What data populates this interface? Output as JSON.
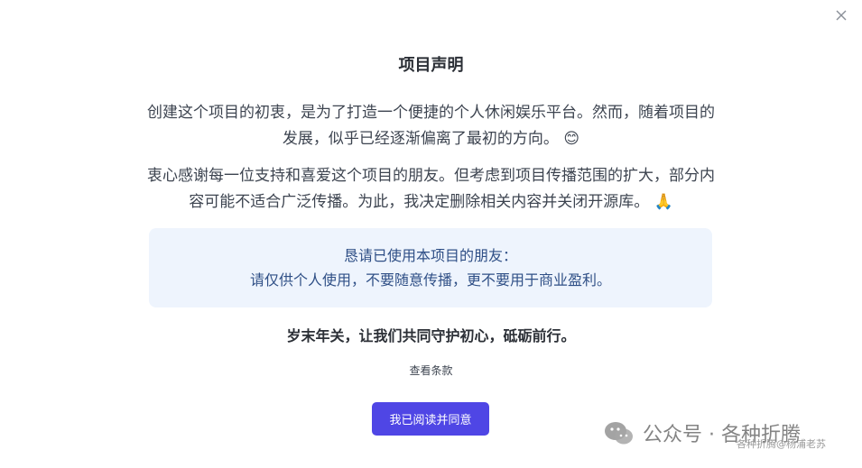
{
  "modal": {
    "title": "项目声明",
    "paragraph1": "创建这个项目的初衷，是为了打造一个便捷的个人休闲娱乐平台。然而，随着项目的发展，似乎已经逐渐偏离了最初的方向。",
    "paragraph1_emoji": "😊",
    "paragraph2": "衷心感谢每一位支持和喜爱这个项目的朋友。但考虑到项目传播范围的扩大，部分内容可能不适合广泛传播。为此，我决定删除相关内容并关闭开源库。",
    "paragraph2_emoji": "🙏",
    "notice_line1": "恳请已使用本项目的朋友：",
    "notice_line2": "请仅供个人使用，不要随意传播，更不要用于商业盈利。",
    "motto": "岁末年关，让我们共同守护初心，砥砺前行。",
    "terms_link": "查看条款",
    "agree_button": "我已阅读并同意",
    "close_icon": "close-icon"
  },
  "watermark": {
    "text": "公众号 · 各种折腾",
    "subtext": "各种折腾@杨浦老苏",
    "icon": "wechat-icon"
  },
  "colors": {
    "accent": "#4f46e5",
    "notice_bg": "#eef4fd",
    "notice_text": "#2f4f86"
  }
}
